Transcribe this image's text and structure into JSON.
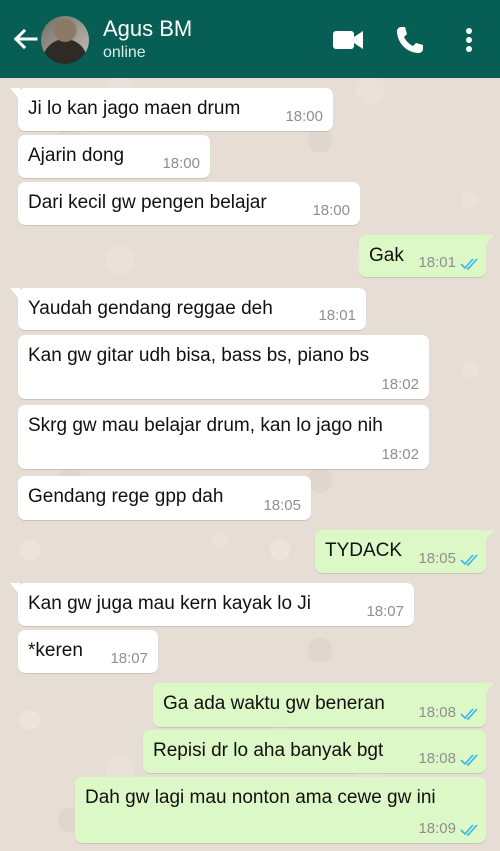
{
  "header": {
    "contact_name": "Agus BM",
    "status": "online",
    "back_icon": "arrow-left-icon",
    "video_icon": "video-call-icon",
    "call_icon": "phone-icon",
    "menu_icon": "more-vert-icon"
  },
  "colors": {
    "header_bg": "#075e54",
    "incoming_bubble": "#ffffff",
    "outgoing_bubble": "#dcf8c6",
    "read_ticks": "#34b7f1"
  },
  "messages": [
    {
      "direction": "in",
      "text": "Ji lo kan jago maen drum",
      "time": "18:00"
    },
    {
      "direction": "in",
      "text": "Ajarin dong",
      "time": "18:00"
    },
    {
      "direction": "in",
      "text": "Dari kecil gw pengen belajar",
      "time": "18:00"
    },
    {
      "direction": "out",
      "text": "Gak",
      "time": "18:01",
      "read": true
    },
    {
      "direction": "in",
      "text": "Yaudah gendang reggae deh",
      "time": "18:01"
    },
    {
      "direction": "in",
      "text": "Kan gw gitar udh bisa, bass bs, piano bs",
      "time": "18:02"
    },
    {
      "direction": "in",
      "text": "Skrg gw mau belajar drum, kan lo jago nih",
      "time": "18:02"
    },
    {
      "direction": "in",
      "text": "Gendang rege gpp dah",
      "time": "18:05"
    },
    {
      "direction": "out",
      "text": "TYDACK",
      "time": "18:05",
      "read": true
    },
    {
      "direction": "in",
      "text": "Kan gw juga mau kern kayak lo Ji",
      "time": "18:07"
    },
    {
      "direction": "in",
      "text": "*keren",
      "time": "18:07"
    },
    {
      "direction": "out",
      "text": "Ga ada waktu gw beneran",
      "time": "18:08",
      "read": true
    },
    {
      "direction": "out",
      "text": "Repisi dr lo aha banyak bgt",
      "time": "18:08",
      "read": true
    },
    {
      "direction": "out",
      "text": "Dah gw lagi mau nonton ama cewe gw ini",
      "time": "18:09",
      "read": true
    }
  ]
}
